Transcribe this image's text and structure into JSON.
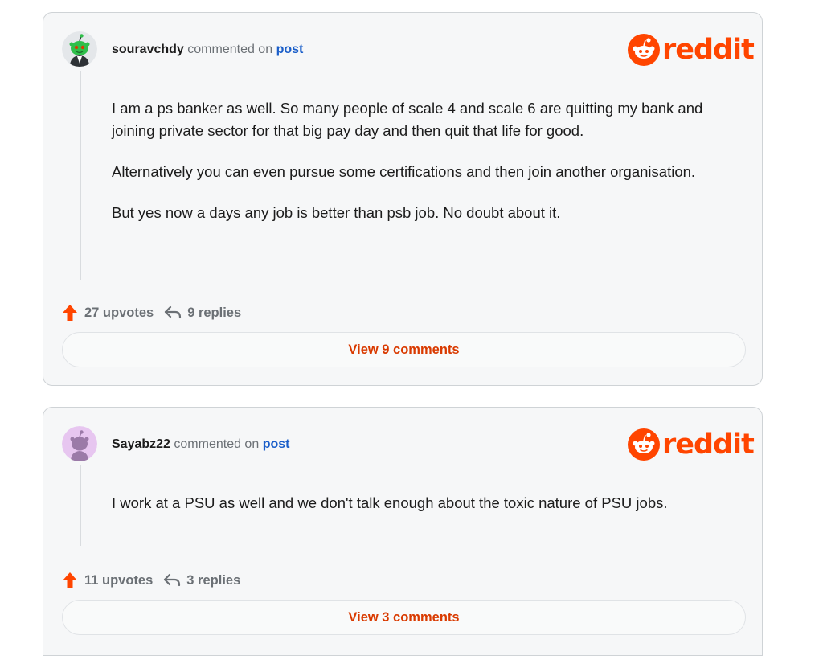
{
  "brand": {
    "logo_text": "reddit",
    "accent_color": "#ff4500",
    "link_color": "#1a5ec9"
  },
  "comments": [
    {
      "username": "souravchdy",
      "action_text": "commented on",
      "post_link": "post",
      "avatar": "snoo-green-avatar",
      "paragraphs": [
        "I am a ps banker as well. So many people of scale 4 and scale 6 are quitting my bank and joining private sector for that big pay day and then quit that life for good.",
        "Alternatively you can even pursue some certifications and then join another organisation.",
        "But yes now a days any job is better than psb job. No doubt about it."
      ],
      "upvotes": "27 upvotes",
      "replies": "9 replies",
      "view_label": "View 9 comments"
    },
    {
      "username": "Sayabz22",
      "action_text": "commented on",
      "post_link": "post",
      "avatar": "snoo-purple-avatar",
      "paragraphs": [
        "I work at a PSU as well and we don't talk enough about the toxic nature of PSU jobs."
      ],
      "upvotes": "11 upvotes",
      "replies": "3 replies",
      "view_label": "View 3 comments"
    }
  ]
}
